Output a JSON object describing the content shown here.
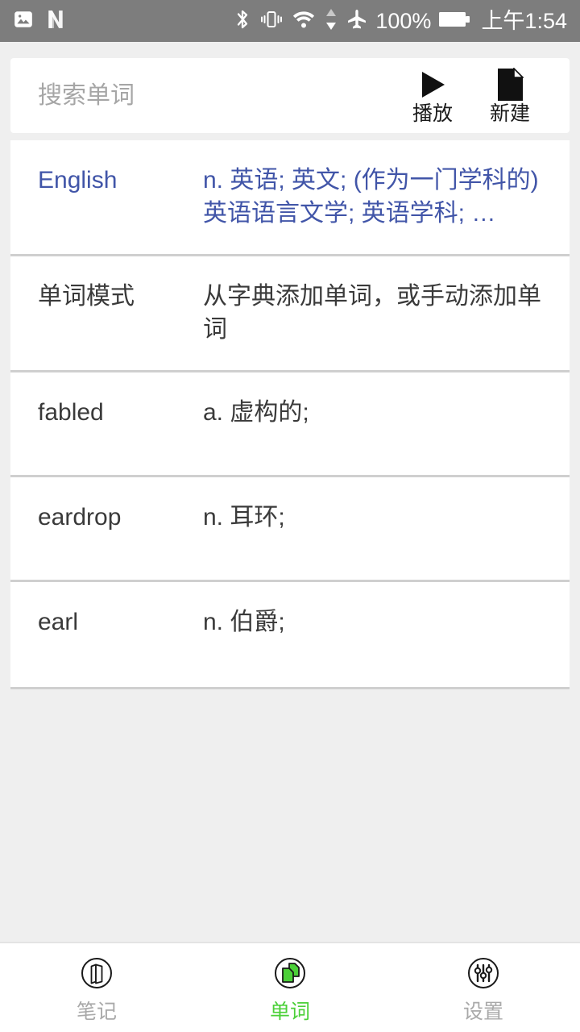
{
  "status_bar": {
    "left_icons": [
      {
        "name": "image-icon",
        "label": "image"
      },
      {
        "name": "netflix-n-icon",
        "label": "N"
      }
    ],
    "right_icons": [
      {
        "name": "bluetooth-icon",
        "label": "bluetooth"
      },
      {
        "name": "vibrate-icon",
        "label": "vibrate"
      },
      {
        "name": "wifi-icon",
        "label": "wifi"
      },
      {
        "name": "data-transfer-icon",
        "label": "data up down"
      },
      {
        "name": "airplane-mode-icon",
        "label": "airplane mode"
      }
    ],
    "battery_percent": "100%",
    "battery_icon": "battery-full-icon",
    "time": "上午1:54",
    "background_color": "#7d7d7d",
    "foreground_color": "#ffffff"
  },
  "search": {
    "placeholder": "搜索单词",
    "value": "",
    "actions": [
      {
        "name": "play-button",
        "icon": "play-icon",
        "label": "播放"
      },
      {
        "name": "new-button",
        "icon": "new-document-icon",
        "label": "新建"
      }
    ]
  },
  "word_list": {
    "rows": [
      {
        "term": "English",
        "definition": "n. 英语; 英文; (作为一门学科的)英语语言文学; 英语学科; …",
        "highlighted": true
      },
      {
        "term": "单词模式",
        "definition": "从字典添加单词，或手动添加单词",
        "highlighted": false
      },
      {
        "term": "fabled",
        "definition": "a. 虚构的;",
        "highlighted": false
      },
      {
        "term": "eardrop",
        "definition": "n. 耳环;",
        "highlighted": false
      },
      {
        "term": "earl",
        "definition": "n. 伯爵;",
        "highlighted": false
      }
    ],
    "highlight_color": "#4155a8",
    "text_color": "#3a3a3a"
  },
  "bottom_nav": {
    "active_color": "#4bd038",
    "inactive_color": "#a9a9a9",
    "items": [
      {
        "name": "sidebar-item-notes",
        "icon": "notebook-icon",
        "label": "笔记",
        "active": false
      },
      {
        "name": "sidebar-item-words",
        "icon": "copy-pages-icon",
        "label": "单词",
        "active": true
      },
      {
        "name": "sidebar-item-settings",
        "icon": "sliders-icon",
        "label": "设置",
        "active": false
      }
    ]
  }
}
